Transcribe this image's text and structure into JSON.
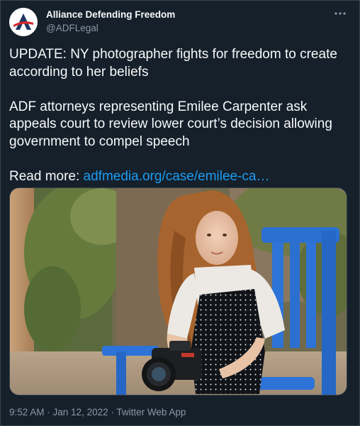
{
  "author": {
    "name": "Alliance Defending Freedom",
    "handle": "@ADFLegal"
  },
  "tweet": {
    "paragraph1": "UPDATE: NY photographer fights for freedom to create according to her beliefs",
    "paragraph2": "ADF attorneys representing Emilee Carpenter ask appeals court to review lower court’s decision allowing government to compel speech",
    "read_more_label": "Read more: ",
    "link_text": "adfmedia.org/case/emilee-ca…"
  },
  "meta": {
    "time": "9:52 AM",
    "separator1": " · ",
    "date": "Jan 12, 2022",
    "separator2": " · ",
    "source": "Twitter Web App"
  },
  "icons": {
    "avatar": "adf-logo-icon",
    "more": "more-horizontal-icon"
  },
  "colors": {
    "background": "#15202b",
    "text": "#f7f9f9",
    "secondary_text": "#8b98a5",
    "link": "#1d9bf0",
    "border": "#38444d",
    "logo_red": "#d7262e",
    "logo_navy": "#1f3663"
  }
}
